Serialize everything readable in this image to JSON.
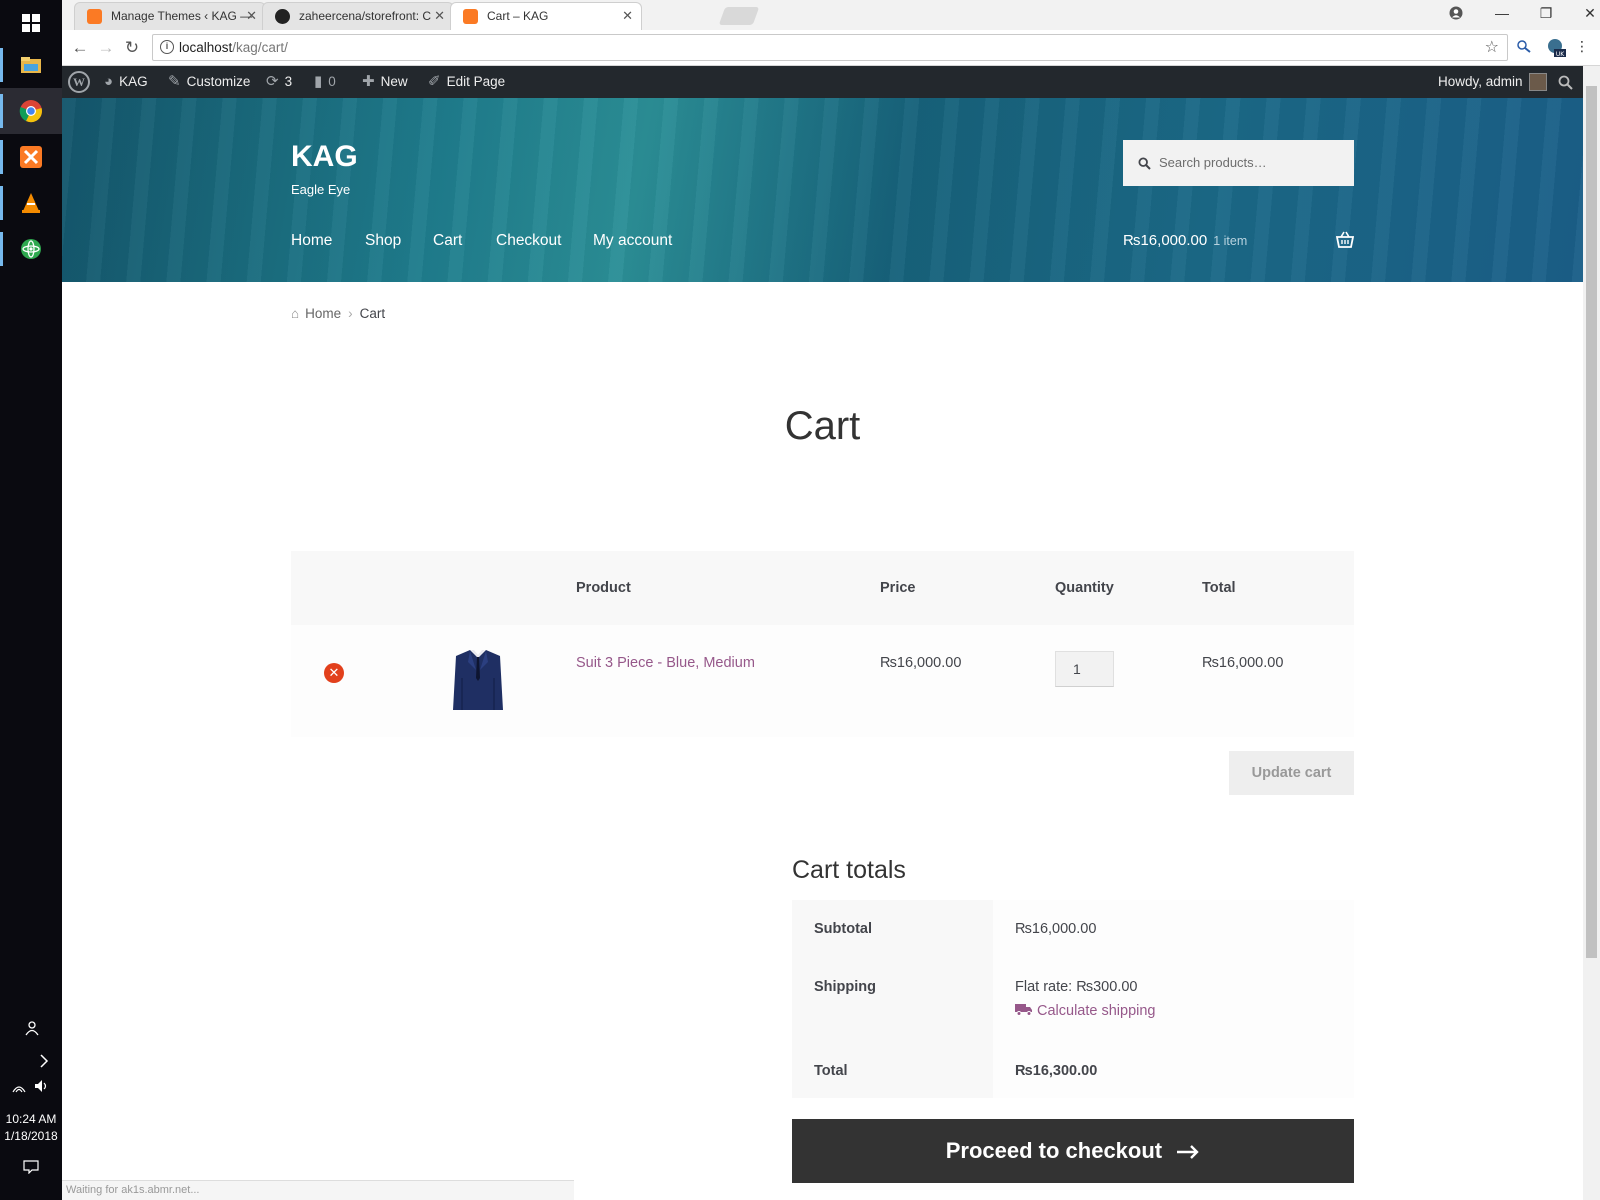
{
  "browser": {
    "tabs": [
      {
        "title": "Manage Themes ‹ KAG —",
        "favicon": "xampp-icon"
      },
      {
        "title": "zaheercena/storefront: C",
        "favicon": "github-icon"
      },
      {
        "title": "Cart – KAG",
        "favicon": "xampp-icon"
      }
    ],
    "address": {
      "host": "localhost",
      "path": "/kag/cart/"
    },
    "status_text": "Waiting for ak1s.abmr.net..."
  },
  "taskbar": {
    "time": "10:24 AM",
    "date": "1/18/2018"
  },
  "adminbar": {
    "site_name": "KAG",
    "customize": "Customize",
    "updates_count": "3",
    "comments_count": "0",
    "new_label": "New",
    "edit_page": "Edit Page",
    "howdy": "Howdy, admin"
  },
  "site": {
    "title": "KAG",
    "tagline": "Eagle Eye",
    "search_placeholder": "Search products…",
    "nav": [
      "Home",
      "Shop",
      "Cart",
      "Checkout",
      "My account"
    ],
    "mini_cart": {
      "amount": "₨16,000.00",
      "count": "1 item"
    }
  },
  "breadcrumb": {
    "home": "Home",
    "current": "Cart"
  },
  "page_title": "Cart",
  "cart": {
    "headers": {
      "product": "Product",
      "price": "Price",
      "quantity": "Quantity",
      "total": "Total"
    },
    "items": [
      {
        "name": "Suit 3 Piece - Blue, Medium",
        "price": "₨16,000.00",
        "quantity": "1",
        "total": "₨16,000.00"
      }
    ],
    "update_label": "Update cart"
  },
  "totals": {
    "title": "Cart totals",
    "subtotal_label": "Subtotal",
    "subtotal": "₨16,000.00",
    "shipping_label": "Shipping",
    "shipping_value": "Flat rate: ₨300.00",
    "calculate_shipping": "Calculate shipping",
    "total_label": "Total",
    "total": "₨16,300.00",
    "checkout_label": "Proceed to checkout"
  },
  "colors": {
    "link": "#96588a",
    "adminbar": "#23282d",
    "checkout": "#333333",
    "remove": "#e2401c"
  }
}
